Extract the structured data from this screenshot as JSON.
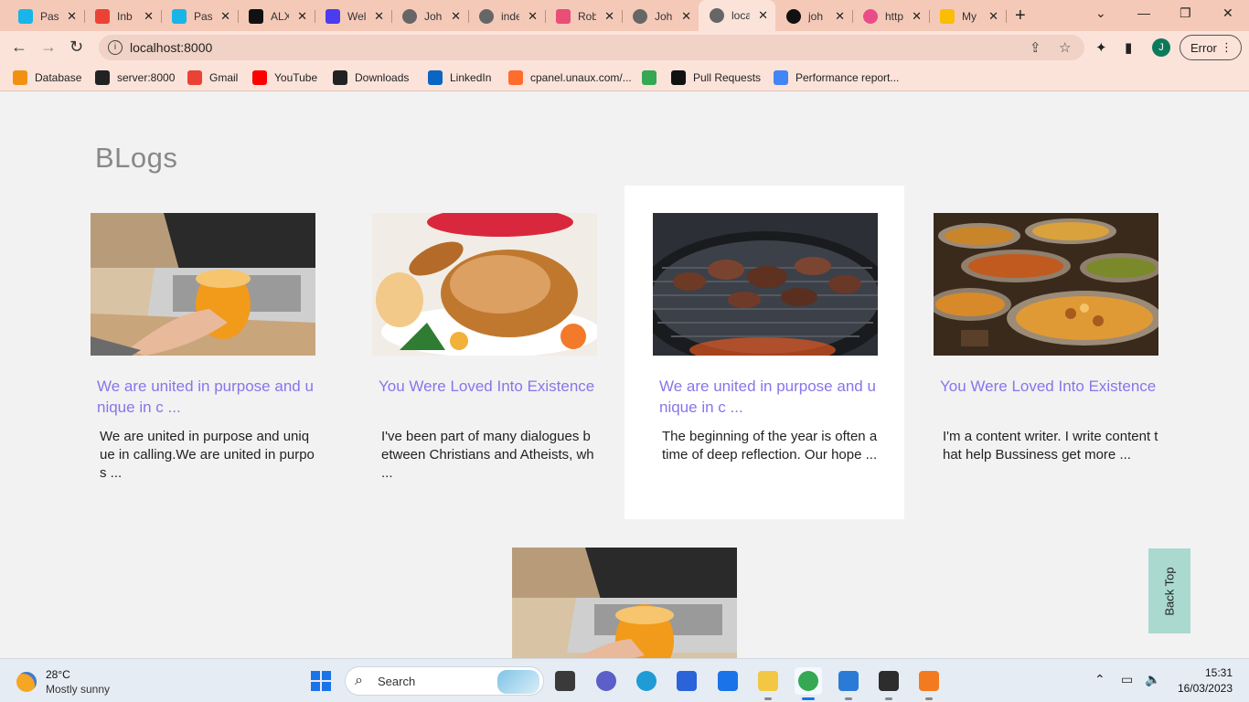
{
  "browser": {
    "tabs": [
      {
        "title": "Pas",
        "icon": "p-icon",
        "color": "#19b5e8"
      },
      {
        "title": "Inb",
        "icon": "gmail-icon",
        "color": "#ea4335"
      },
      {
        "title": "Pas",
        "icon": "p-icon",
        "color": "#19b5e8"
      },
      {
        "title": "ALX",
        "icon": "alx-icon",
        "color": "#111111"
      },
      {
        "title": "Wel",
        "icon": "w-icon",
        "color": "#4b3cf0"
      },
      {
        "title": "Joh",
        "icon": "globe-icon",
        "color": "#666666"
      },
      {
        "title": "inde",
        "icon": "globe-icon",
        "color": "#666666"
      },
      {
        "title": "Rob",
        "icon": "colorful-icon",
        "color": "#e94e77"
      },
      {
        "title": "Joh",
        "icon": "globe-icon",
        "color": "#666666"
      },
      {
        "title": "loca",
        "icon": "globe-icon",
        "color": "#666666"
      },
      {
        "title": "joh",
        "icon": "github-icon",
        "color": "#111111"
      },
      {
        "title": "http",
        "icon": "dribbble-icon",
        "color": "#ea4c89"
      },
      {
        "title": "My",
        "icon": "drive-icon",
        "color": "#fbbc05"
      }
    ],
    "active_tab_index": 9,
    "address": "localhost:8000",
    "error_label": "Error",
    "profile_initial": "J",
    "bookmarks": [
      {
        "label": "Database",
        "icon": "phpmyadmin-icon",
        "color": "#f29111"
      },
      {
        "label": "server:8000",
        "icon": "globe-icon",
        "color": "#222222"
      },
      {
        "label": "Gmail",
        "icon": "gmail-icon",
        "color": "#ea4335"
      },
      {
        "label": "YouTube",
        "icon": "youtube-icon",
        "color": "#ff0000"
      },
      {
        "label": "Downloads",
        "icon": "download-icon",
        "color": "#222222"
      },
      {
        "label": "LinkedIn",
        "icon": "linkedin-icon",
        "color": "#0a66c2"
      },
      {
        "label": "cpanel.unaux.com/...",
        "icon": "cpanel-icon",
        "color": "#ff6c2c"
      },
      {
        "label": "",
        "icon": "maps-icon",
        "color": "#34a853"
      },
      {
        "label": "Pull Requests",
        "icon": "github-icon",
        "color": "#111111"
      },
      {
        "label": "Performance report...",
        "icon": "google-icon",
        "color": "#4285f4"
      }
    ]
  },
  "page": {
    "title": "BLogs",
    "cards": [
      {
        "title": "We are united in purpose and unique in c ...",
        "excerpt": "We are united in purpose and unique in calling.We are united in purpos ...",
        "image": "laptop-juice"
      },
      {
        "title": "You Were Loved Into Existence",
        "excerpt": "I've been part of many dialogues between Christians and Atheists, wh ...",
        "image": "roast-chicken"
      },
      {
        "title": "We are united in purpose and unique in c ...",
        "excerpt": "The beginning of the year is often a time of deep reflection. Our hope ...",
        "image": "grill"
      },
      {
        "title": "You Were Loved Into Existence",
        "excerpt": "I'm a content writer. I write content that help Bussiness get more ...",
        "image": "curry-pots"
      }
    ],
    "back_top_label": "Back Top"
  },
  "colors": {
    "accent_title": "#8a74ea",
    "back_top_bg": "#aad9cf",
    "tab_strip": "#f5c9b8",
    "toolbar": "#fbe3da"
  },
  "taskbar": {
    "weather_temp": "28°C",
    "weather_desc": "Mostly sunny",
    "search_label": "Search",
    "apps": [
      "task-view-icon",
      "teams-chat-icon",
      "edge-icon",
      "store-icon",
      "mail-icon",
      "file-explorer-icon",
      "chrome-icon",
      "vscode-icon",
      "terminal-icon",
      "xampp-icon"
    ],
    "time": "15:31",
    "date": "16/03/2023"
  }
}
